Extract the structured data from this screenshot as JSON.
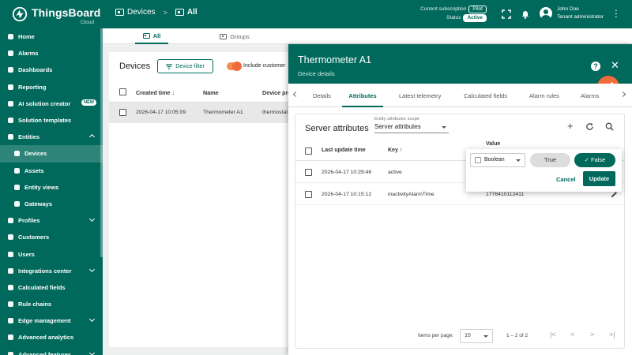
{
  "header": {
    "logo_name": "ThingsBoard",
    "logo_sub": "Cloud",
    "breadcrumbs": [
      {
        "label": "Devices",
        "icon": "devices-icon"
      },
      {
        "label": "All",
        "icon": "devices-icon"
      }
    ],
    "breadcrumb_sep": ">",
    "subscription_label": "Current subscription",
    "subscription_value": "Pilot",
    "status_label": "Status",
    "status_value": "Active",
    "user_name": "John Doe",
    "user_role": "Tenant administrator"
  },
  "sidebar": {
    "items": [
      {
        "label": "Home",
        "icon": "home-icon"
      },
      {
        "label": "Alarms",
        "icon": "alarm-icon"
      },
      {
        "label": "Dashboards",
        "icon": "dashboard-icon"
      },
      {
        "label": "Reporting",
        "icon": "report-icon"
      },
      {
        "label": "AI solution creator",
        "icon": "ai-icon",
        "badge": "NEW"
      },
      {
        "label": "Solution templates",
        "icon": "template-icon"
      },
      {
        "label": "Entities",
        "icon": "entities-icon",
        "expanded": true
      },
      {
        "label": "Devices",
        "icon": "devices-icon",
        "child": true,
        "selected": true
      },
      {
        "label": "Assets",
        "icon": "assets-icon",
        "child": true
      },
      {
        "label": "Entity views",
        "icon": "entity-views-icon",
        "child": true
      },
      {
        "label": "Gateways",
        "icon": "gateways-icon",
        "child": true
      },
      {
        "label": "Profiles",
        "icon": "profiles-icon",
        "collapsible": true
      },
      {
        "label": "Customers",
        "icon": "customers-icon"
      },
      {
        "label": "Users",
        "icon": "users-icon"
      },
      {
        "label": "Integrations center",
        "icon": "integrations-icon",
        "collapsible": true
      },
      {
        "label": "Calculated fields",
        "icon": "calculated-fields-icon"
      },
      {
        "label": "Rule chains",
        "icon": "rule-chains-icon"
      },
      {
        "label": "Edge management",
        "icon": "edge-icon",
        "collapsible": true
      },
      {
        "label": "Advanced analytics",
        "icon": "analytics-icon"
      },
      {
        "label": "Advanced features",
        "icon": "advanced-features-icon",
        "collapsible": true
      }
    ]
  },
  "top_tabs": [
    {
      "label": "All",
      "active": true
    },
    {
      "label": "Groups",
      "active": false
    }
  ],
  "devices_panel": {
    "title": "Devices",
    "filter_label": "Device filter",
    "include_label": "Include customer",
    "columns": [
      "Created time",
      "Name",
      "Device pro"
    ],
    "rows": [
      {
        "created": "2026-04-17 10:05:09",
        "name": "Thermometer A1",
        "profile": "thermostat"
      }
    ]
  },
  "drawer": {
    "title": "Thermometer A1",
    "subtitle": "Device details",
    "tabs": [
      "Details",
      "Attributes",
      "Latest telemetry",
      "Calculated fields",
      "Alarm rules",
      "Alarms"
    ],
    "active_tab": "Attributes"
  },
  "attributes": {
    "title": "Server attributes",
    "scope_label": "Entity attributes scope",
    "scope_value": "Server attributes",
    "columns": [
      "Last update time",
      "Key",
      "Value"
    ],
    "rows": [
      {
        "time": "2026-04-17 10:29:46",
        "key": "active",
        "value": ""
      },
      {
        "time": "2026-04-17 10:15:12",
        "key": "inactivityAlarmTime",
        "value": "1776410112411"
      }
    ],
    "items_per_page_label": "Items per page:",
    "items_per_page": "10",
    "range_text": "1 – 2 of 2"
  },
  "edit_popup": {
    "type_value": "Boolean",
    "true_label": "True",
    "false_label": "False",
    "cancel_label": "Cancel",
    "update_label": "Update"
  },
  "colors": {
    "primary": "#00695c",
    "accent": "#ef6c3a"
  }
}
